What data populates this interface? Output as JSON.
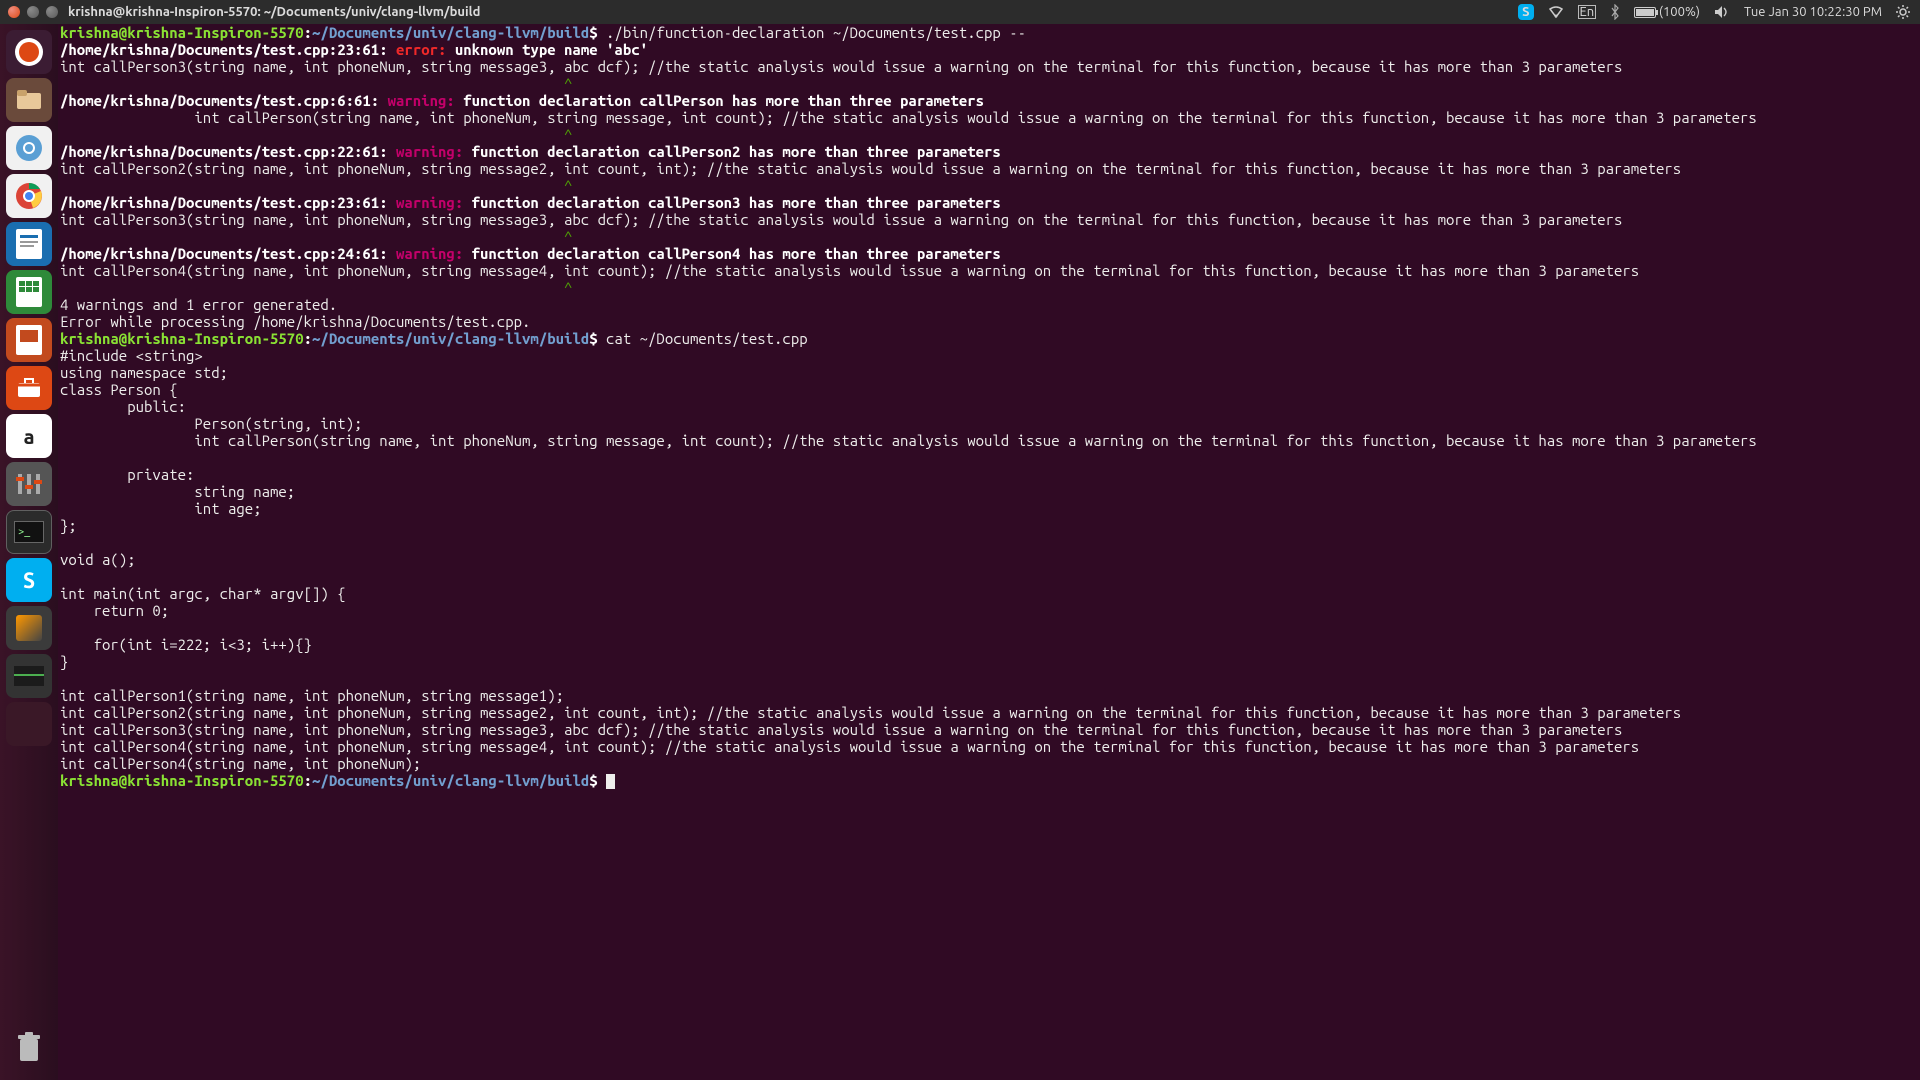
{
  "menubar": {
    "title": "krishna@krishna-Inspiron-5570: ~/Documents/univ/clang-llvm/build",
    "skype_letter": "S",
    "lang": "En",
    "battery_pct": "(100%)",
    "clock": "Tue Jan 30 10:22:30 PM"
  },
  "launcher": {
    "amazon_letter": "a",
    "skype_letter": "S",
    "terminal_prompt": ">_"
  },
  "prompt": {
    "user_host": "krishna@krishna-Inspiron-5570",
    "sep": ":",
    "cwd": "~/Documents/univ/clang-llvm/build",
    "dollar": "$"
  },
  "cmd1": " ./bin/function-declaration ~/Documents/test.cpp --",
  "err1": {
    "loc": "/home/krishna/Documents/test.cpp:23:61: ",
    "kw": "error: ",
    "msg": "unknown type name 'abc'",
    "code": "int callPerson3(string name, int phoneNum, string message3, abc dcf); //the static analysis would issue a warning on the terminal for this function, because it has more than 3 parameters",
    "caret": "                                                            ^"
  },
  "w1": {
    "loc": "/home/krishna/Documents/test.cpp:6:61: ",
    "kw": "warning: ",
    "msg": "function declaration callPerson has more than three parameters",
    "code": "                int callPerson(string name, int phoneNum, string message, int count); //the static analysis would issue a warning on the terminal for this function, because it has more than 3 parameters",
    "caret": "                                                            ^"
  },
  "w2": {
    "loc": "/home/krishna/Documents/test.cpp:22:61: ",
    "kw": "warning: ",
    "msg": "function declaration callPerson2 has more than three parameters",
    "code": "int callPerson2(string name, int phoneNum, string message2, int count, int); //the static analysis would issue a warning on the terminal for this function, because it has more than 3 parameters",
    "caret": "                                                            ^"
  },
  "w3": {
    "loc": "/home/krishna/Documents/test.cpp:23:61: ",
    "kw": "warning: ",
    "msg": "function declaration callPerson3 has more than three parameters",
    "code": "int callPerson3(string name, int phoneNum, string message3, abc dcf); //the static analysis would issue a warning on the terminal for this function, because it has more than 3 parameters",
    "caret": "                                                            ^"
  },
  "w4": {
    "loc": "/home/krishna/Documents/test.cpp:24:61: ",
    "kw": "warning: ",
    "msg": "function declaration callPerson4 has more than three parameters",
    "code": "int callPerson4(string name, int phoneNum, string message4, int count); //the static analysis would issue a warning on the terminal for this function, because it has more than 3 parameters",
    "caret": "                                                            ^"
  },
  "summary1": "4 warnings and 1 error generated.",
  "summary2": "Error while processing /home/krishna/Documents/test.cpp.",
  "cmd2": " cat ~/Documents/test.cpp",
  "src": [
    "#include <string>",
    "using namespace std;",
    "class Person {",
    "        public:",
    "                Person(string, int);",
    "                int callPerson(string name, int phoneNum, string message, int count); //the static analysis would issue a warning on the terminal for this function, because it has more than 3 parameters",
    "",
    "        private:",
    "                string name;",
    "                int age;",
    "};",
    "",
    "void a();",
    "",
    "int main(int argc, char* argv[]) {",
    "    return 0;",
    "",
    "    for(int i=222; i<3; i++){}",
    "}",
    "",
    "int callPerson1(string name, int phoneNum, string message1);",
    "int callPerson2(string name, int phoneNum, string message2, int count, int); //the static analysis would issue a warning on the terminal for this function, because it has more than 3 parameters",
    "int callPerson3(string name, int phoneNum, string message3, abc dcf); //the static analysis would issue a warning on the terminal for this function, because it has more than 3 parameters",
    "int callPerson4(string name, int phoneNum, string message4, int count); //the static analysis would issue a warning on the terminal for this function, because it has more than 3 parameters",
    "int callPerson4(string name, int phoneNum);"
  ]
}
